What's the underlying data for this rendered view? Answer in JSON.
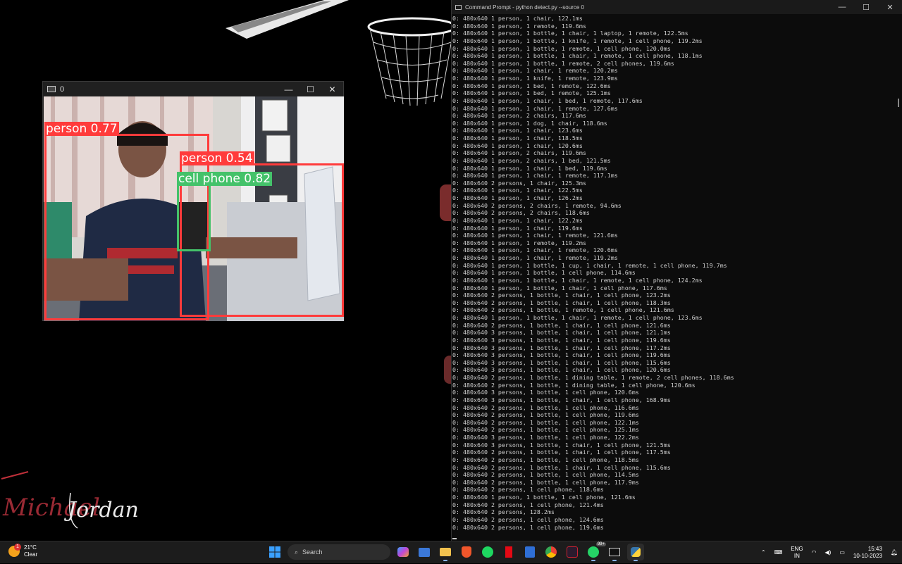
{
  "camera_window": {
    "title": "0",
    "controls": {
      "minimize": "—",
      "maximize": "☐",
      "close": "✕"
    },
    "detections": [
      {
        "label": "person 0.77",
        "class": "person",
        "confidence": 0.77,
        "color": "#ff3b3b"
      },
      {
        "label": "person 0.54",
        "class": "person",
        "confidence": 0.54,
        "color": "#ff3b3b"
      },
      {
        "label": "cell phone 0.82",
        "class": "cell phone",
        "confidence": 0.82,
        "color": "#44c26a"
      }
    ]
  },
  "terminal": {
    "title": "Command Prompt - python  detect.py --source 0",
    "controls": {
      "minimize": "—",
      "maximize": "☐",
      "close": "✕"
    },
    "lines": [
      "0: 480x640 1 person, 1 chair, 122.1ms",
      "0: 480x640 1 person, 1 remote, 119.6ms",
      "0: 480x640 1 person, 1 bottle, 1 chair, 1 laptop, 1 remote, 122.5ms",
      "0: 480x640 1 person, 1 bottle, 1 knife, 1 remote, 1 cell phone, 119.2ms",
      "0: 480x640 1 person, 1 bottle, 1 remote, 1 cell phone, 120.0ms",
      "0: 480x640 1 person, 1 bottle, 1 chair, 1 remote, 1 cell phone, 118.1ms",
      "0: 480x640 1 person, 1 bottle, 1 remote, 2 cell phones, 119.6ms",
      "0: 480x640 1 person, 1 chair, 1 remote, 120.2ms",
      "0: 480x640 1 person, 1 knife, 1 remote, 123.9ms",
      "0: 480x640 1 person, 1 bed, 1 remote, 122.6ms",
      "0: 480x640 1 person, 1 bed, 1 remote, 125.1ms",
      "0: 480x640 1 person, 1 chair, 1 bed, 1 remote, 117.6ms",
      "0: 480x640 1 person, 1 chair, 1 remote, 127.6ms",
      "0: 480x640 1 person, 2 chairs, 117.6ms",
      "0: 480x640 1 person, 1 dog, 1 chair, 118.6ms",
      "0: 480x640 1 person, 1 chair, 123.6ms",
      "0: 480x640 1 person, 1 chair, 118.5ms",
      "0: 480x640 1 person, 1 chair, 120.6ms",
      "0: 480x640 1 person, 2 chairs, 119.6ms",
      "0: 480x640 1 person, 2 chairs, 1 bed, 121.5ms",
      "0: 480x640 1 person, 1 chair, 1 bed, 119.6ms",
      "0: 480x640 1 person, 1 chair, 1 remote, 117.1ms",
      "0: 480x640 2 persons, 1 chair, 125.3ms",
      "0: 480x640 1 person, 1 chair, 122.5ms",
      "0: 480x640 1 person, 1 chair, 126.2ms",
      "0: 480x640 2 persons, 2 chairs, 1 remote, 94.6ms",
      "0: 480x640 2 persons, 2 chairs, 118.6ms",
      "0: 480x640 1 person, 1 chair, 122.2ms",
      "0: 480x640 1 person, 1 chair, 119.6ms",
      "0: 480x640 1 person, 1 chair, 1 remote, 121.6ms",
      "0: 480x640 1 person, 1 remote, 119.2ms",
      "0: 480x640 1 person, 1 chair, 1 remote, 120.6ms",
      "0: 480x640 1 person, 1 chair, 1 remote, 119.2ms",
      "0: 480x640 1 person, 1 bottle, 1 cup, 1 chair, 1 remote, 1 cell phone, 119.7ms",
      "0: 480x640 1 person, 1 bottle, 1 cell phone, 114.6ms",
      "0: 480x640 1 person, 1 bottle, 1 chair, 1 remote, 1 cell phone, 124.2ms",
      "0: 480x640 1 person, 1 bottle, 1 chair, 1 cell phone, 117.6ms",
      "0: 480x640 2 persons, 1 bottle, 1 chair, 1 cell phone, 123.2ms",
      "0: 480x640 2 persons, 1 bottle, 1 chair, 1 cell phone, 118.3ms",
      "0: 480x640 2 persons, 1 bottle, 1 remote, 1 cell phone, 121.6ms",
      "0: 480x640 1 person, 1 bottle, 1 chair, 1 remote, 1 cell phone, 123.6ms",
      "0: 480x640 2 persons, 1 bottle, 1 chair, 1 cell phone, 121.6ms",
      "0: 480x640 3 persons, 1 bottle, 1 chair, 1 cell phone, 121.1ms",
      "0: 480x640 3 persons, 1 bottle, 1 chair, 1 cell phone, 119.6ms",
      "0: 480x640 3 persons, 1 bottle, 1 chair, 1 cell phone, 117.2ms",
      "0: 480x640 3 persons, 1 bottle, 1 chair, 1 cell phone, 119.6ms",
      "0: 480x640 3 persons, 1 bottle, 1 chair, 1 cell phone, 115.6ms",
      "0: 480x640 3 persons, 1 bottle, 1 chair, 1 cell phone, 120.6ms",
      "0: 480x640 2 persons, 1 bottle, 1 dining table, 1 remote, 2 cell phones, 118.6ms",
      "0: 480x640 2 persons, 1 bottle, 1 dining table, 1 cell phone, 120.6ms",
      "0: 480x640 3 persons, 1 bottle, 1 cell phone, 120.6ms",
      "0: 480x640 3 persons, 1 bottle, 1 chair, 1 cell phone, 168.9ms",
      "0: 480x640 2 persons, 1 bottle, 1 cell phone, 116.6ms",
      "0: 480x640 2 persons, 1 bottle, 1 cell phone, 119.6ms",
      "0: 480x640 2 persons, 1 bottle, 1 cell phone, 122.1ms",
      "0: 480x640 2 persons, 1 bottle, 1 cell phone, 125.1ms",
      "0: 480x640 3 persons, 1 bottle, 1 cell phone, 122.2ms",
      "0: 480x640 3 persons, 1 bottle, 1 chair, 1 cell phone, 121.5ms",
      "0: 480x640 2 persons, 1 bottle, 1 chair, 1 cell phone, 117.5ms",
      "0: 480x640 2 persons, 1 bottle, 1 cell phone, 118.5ms",
      "0: 480x640 2 persons, 1 bottle, 1 chair, 1 cell phone, 115.6ms",
      "0: 480x640 2 persons, 1 bottle, 1 cell phone, 114.5ms",
      "0: 480x640 2 persons, 1 bottle, 1 cell phone, 117.9ms",
      "0: 480x640 2 persons, 1 cell phone, 118.6ms",
      "0: 480x640 1 person, 1 bottle, 1 cell phone, 121.6ms",
      "0: 480x640 2 persons, 1 cell phone, 121.4ms",
      "0: 480x640 2 persons, 128.2ms",
      "0: 480x640 2 persons, 1 cell phone, 124.6ms",
      "0: 480x640 2 persons, 1 cell phone, 119.6ms"
    ]
  },
  "desktop": {
    "signature_text": "Michael Jordan"
  },
  "taskbar": {
    "weather": {
      "temp": "21°C",
      "condition": "Clear",
      "badge": "1"
    },
    "search_placeholder": "Search",
    "apps": [
      "start-icon",
      "search",
      "copilot-icon",
      "photos-icon",
      "file-explorer-icon",
      "brave-icon",
      "spotify-icon",
      "netflix-icon",
      "calculator-icon",
      "chrome-icon",
      "app-icon",
      "whatsapp-icon",
      "terminal-icon",
      "python-icon"
    ],
    "whatsapp_badge": "99+",
    "language": {
      "line1": "ENG",
      "line2": "IN"
    },
    "clock": {
      "time": "15:43",
      "date": "10-10-2023"
    }
  },
  "colors": {
    "detect_red": "#ff3b3b",
    "detect_green": "#44c26a",
    "taskbar": "#1c1c1c",
    "terminal_bg": "#0c0c0c"
  }
}
